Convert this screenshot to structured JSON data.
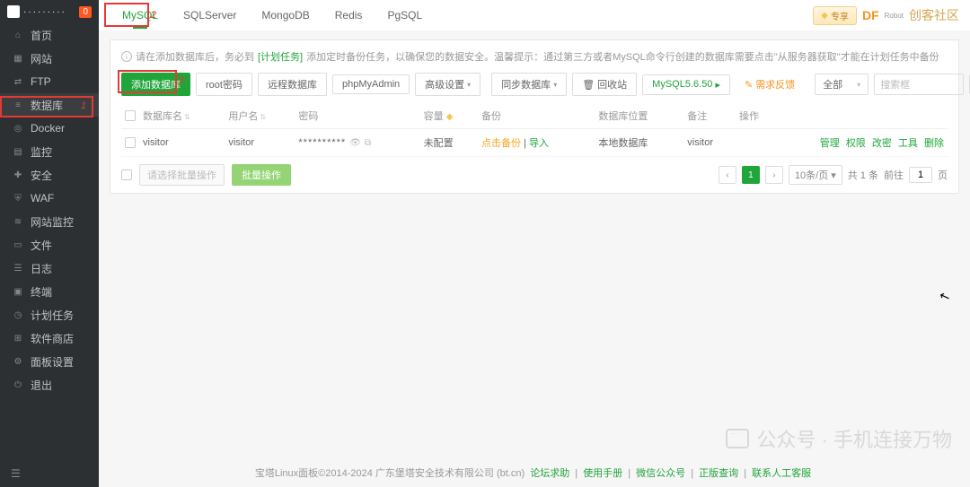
{
  "sidebar": {
    "ip_mask": "·········",
    "badge": "0",
    "items": [
      {
        "label": "首页",
        "icon": "⌂"
      },
      {
        "label": "网站",
        "icon": "▦"
      },
      {
        "label": "FTP",
        "icon": "⇄"
      },
      {
        "label": "数据库",
        "icon": "≡"
      },
      {
        "label": "Docker",
        "icon": "◎"
      },
      {
        "label": "监控",
        "icon": "▤"
      },
      {
        "label": "安全",
        "icon": "✚"
      },
      {
        "label": "WAF",
        "icon": "⛨"
      },
      {
        "label": "网站监控",
        "icon": "≋"
      },
      {
        "label": "文件",
        "icon": "▭"
      },
      {
        "label": "日志",
        "icon": "☰"
      },
      {
        "label": "终端",
        "icon": "▣"
      },
      {
        "label": "计划任务",
        "icon": "◷"
      },
      {
        "label": "软件商店",
        "icon": "⊞"
      },
      {
        "label": "面板设置",
        "icon": "⚙"
      },
      {
        "label": "退出",
        "icon": "⏻"
      }
    ],
    "annotations": {
      "num1": "1"
    }
  },
  "tabs": {
    "items": [
      "MySQL",
      "SQLServer",
      "MongoDB",
      "Redis",
      "PgSQL"
    ],
    "vip_label": "专享",
    "logo_df": "DF",
    "logo_sub": "Robot",
    "logo_cn": "创客社区",
    "num2": "2"
  },
  "info": {
    "text_a": "请在添加数据库后，务必到",
    "link_a": "[计划任务]",
    "text_b": "添加定时备份任务，以确保您的数据安全。温馨提示：通过第三方或者MySQL命令行创建的数据库需要点击\"从服务器获取\"才能在计划任务中备份"
  },
  "toolbar": {
    "add": "添加数据库",
    "root": "root密码",
    "remote": "远程数据库",
    "pma": "phpMyAdmin",
    "adv": "高级设置",
    "sync": "同步数据库",
    "recycle": "回收站",
    "mysql_ver": "MySQL5.6.50",
    "feedback": "需求反馈",
    "filter_all": "全部",
    "search_ph": "搜索框",
    "num3": "3"
  },
  "table": {
    "headers": {
      "name": "数据库名",
      "user": "用户名",
      "pwd": "密码",
      "quota": "容量",
      "backup": "备份",
      "location": "数据库位置",
      "remark": "备注",
      "ops": "操作"
    },
    "row": {
      "name": "visitor",
      "user": "visitor",
      "pwd": "**********",
      "quota": "未配置",
      "backup_a": "点击备份",
      "backup_b": "导入",
      "location": "本地数据库",
      "remark": "visitor",
      "ops": {
        "manage": "管理",
        "perm": "权限",
        "change": "改密",
        "tools": "工具",
        "del": "删除"
      }
    }
  },
  "batch": {
    "placeholder": "请选择批量操作",
    "btn": "批量操作"
  },
  "pager": {
    "page": "1",
    "per": "10条/页",
    "total_lbl": "共 1 条",
    "goto_lbl": "前往",
    "goto_val": "1",
    "page_suffix": "页"
  },
  "footer": {
    "copyright": "宝塔Linux面板©2014-2024 广东堡塔安全技术有限公司 (bt.cn)",
    "links": [
      "论坛求助",
      "使用手册",
      "微信公众号",
      "正版查询",
      "联系人工客服"
    ]
  },
  "watermark": "公众号 · 手机连接万物"
}
